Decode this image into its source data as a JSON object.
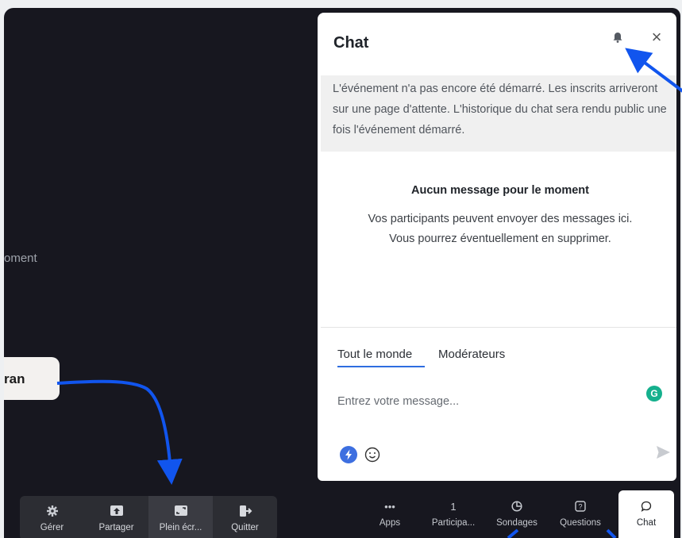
{
  "left_text": "oment",
  "callout": {
    "text": "ran"
  },
  "toolbar": {
    "items": [
      {
        "label": "Gérer",
        "icon": "gear-icon"
      },
      {
        "label": "Partager",
        "icon": "share-screen-icon"
      },
      {
        "label": "Plein écr...",
        "icon": "fullscreen-icon"
      },
      {
        "label": "Quitter",
        "icon": "exit-icon"
      }
    ]
  },
  "chat": {
    "title": "Chat",
    "notice": "L'événement n'a pas encore été démarré. Les inscrits arriveront sur une page d'attente. L'historique du chat sera rendu public une fois l'événement démarré.",
    "empty_title": "Aucun message pour le moment",
    "empty_body_line1": "Vos participants peuvent envoyer des messages ici.",
    "empty_body_line2": "Vous pourrez éventuellement en supprimer.",
    "tabs": [
      "Tout le monde",
      "Modérateurs"
    ],
    "input_placeholder": "Entrez votre message...",
    "grammarly_letter": "G"
  },
  "rightbar": {
    "items": [
      {
        "label": "Apps",
        "top": "•••",
        "icon": "more-icon"
      },
      {
        "label": "Participa...",
        "top": "1",
        "icon": "count"
      },
      {
        "label": "Sondages",
        "icon": "pie-icon"
      },
      {
        "label": "Questions",
        "icon": "question-icon"
      },
      {
        "label": "Chat",
        "icon": "chat-bubble-icon"
      }
    ]
  },
  "colors": {
    "accent": "#2e6de0",
    "arrow": "#1155ee",
    "stage": "#17171f"
  }
}
